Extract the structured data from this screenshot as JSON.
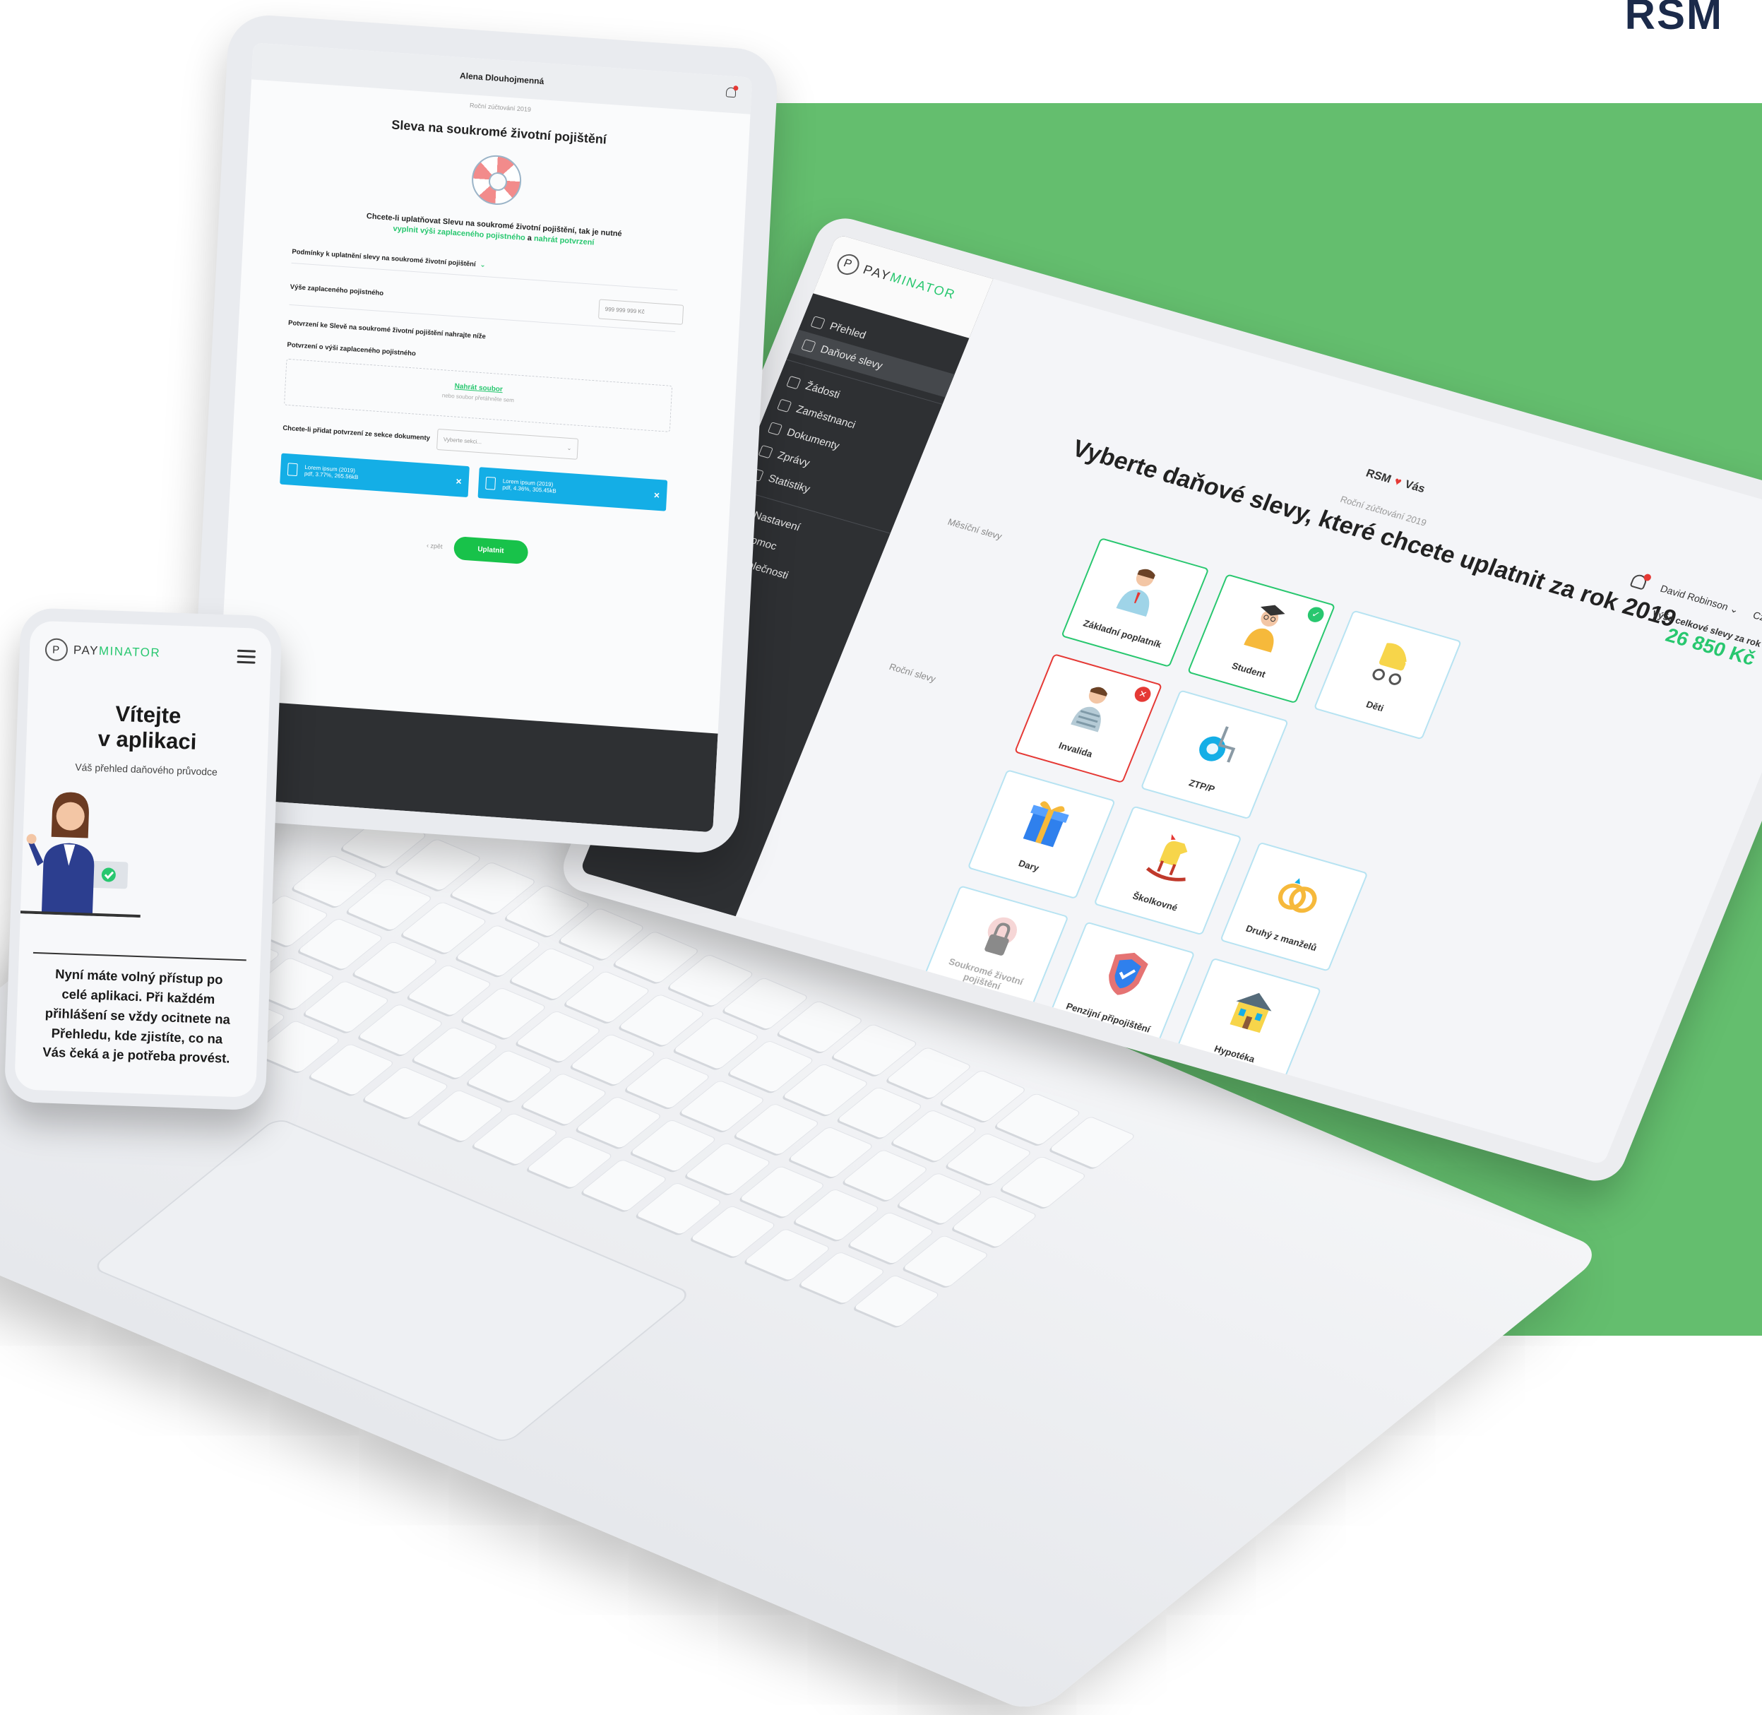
{
  "brand": "RSM",
  "colors": {
    "green_bg": "#64be6e",
    "accent_green": "#28c76f",
    "danger": "#e53935",
    "file_blue": "#14aee6",
    "sidebar_dark": "#2e3033"
  },
  "laptop": {
    "logo": {
      "pay": "PAY",
      "minator": "MINATOR",
      "mark": "P"
    },
    "nav": [
      {
        "label": "Přehled",
        "icon": "overview-icon"
      },
      {
        "label": "Daňové slevy",
        "icon": "tag-icon",
        "active": true
      },
      {
        "label": "Žádosti",
        "icon": "request-icon"
      },
      {
        "label": "Zaměstnanci",
        "icon": "people-icon"
      },
      {
        "label": "Dokumenty",
        "icon": "document-icon"
      },
      {
        "label": "Zprávy",
        "icon": "message-icon"
      },
      {
        "label": "Statistiky",
        "icon": "chart-icon"
      },
      {
        "label": "Nastavení",
        "icon": "gear-icon"
      },
      {
        "label": "Pomoc",
        "icon": "help-icon"
      },
      {
        "label": "Společnosti",
        "icon": "company-icon"
      }
    ],
    "company_left": "RSM",
    "company_right": "Vás",
    "subtitle": "Roční zúčtování 2019",
    "title": "Vyberte daňové slevy, které chcete uplatnit za rok 2019",
    "user": "David Robinson",
    "language": "Czech",
    "total_label": "Výše celkové slevy za rok",
    "total_value": "26 850 Kč",
    "section_monthly": "Měsíční slevy",
    "section_yearly": "Roční slevy",
    "tiles": [
      {
        "label": "Základní poplatník",
        "state": "selected",
        "icon": "taxpayer-icon"
      },
      {
        "label": "Student",
        "state": "selected",
        "icon": "student-icon"
      },
      {
        "label": "Děti",
        "state": "normal",
        "icon": "stroller-icon"
      },
      {
        "label": "Invalida",
        "state": "rejected",
        "icon": "disabled-person-icon"
      },
      {
        "label": "ZTP/P",
        "state": "normal",
        "icon": "wheelchair-icon"
      },
      {
        "label": "",
        "state": "spacer",
        "icon": ""
      },
      {
        "label": "Dary",
        "state": "normal",
        "icon": "gift-icon"
      },
      {
        "label": "Školkovné",
        "state": "normal",
        "icon": "rocking-horse-icon"
      },
      {
        "label": "Druhý z manželů",
        "state": "normal",
        "icon": "rings-icon"
      },
      {
        "label": "Soukromé životní pojištění",
        "state": "disabled",
        "icon": "lock-icon"
      },
      {
        "label": "Penzijní připojištění",
        "state": "normal",
        "icon": "shield-icon"
      },
      {
        "label": "Hypotéka",
        "state": "normal",
        "icon": "house-icon"
      }
    ]
  },
  "tablet": {
    "user": "Alena Dlouhojmenná",
    "subtitle": "Roční zúčtování 2019",
    "title": "Sleva na soukromé životní pojištění",
    "intro_1": "Chcete-li uplatňovat Slevu na soukromé životní pojištění, tak je nutné",
    "intro_link_1": "vyplnit výši zaplaceného pojistného",
    "intro_and": "a",
    "intro_link_2": "nahrát potvrzení",
    "conditions": "Podmínky k uplatnění slevy na soukromé životní pojištění",
    "amount_label": "Výše zaplaceného pojistného",
    "amount_placeholder": "999 999 999 Kč",
    "upload_heading": "Potvrzení ke Slevě na soukromé životní pojištění nahrajte níže",
    "upload_label": "Potvrzení o výši zaplaceného pojistného",
    "upload_link": "Nahrát soubor",
    "upload_hint": "nebo soubor přetáhněte sem",
    "docs_label": "Chcete-li přidat potvrzení ze sekce dokumenty",
    "docs_placeholder": "Vyberte sekci...",
    "files": [
      {
        "name": "Lorem ipsum (2019)",
        "meta": "pdf, 3.77%, 265.56kB"
      },
      {
        "name": "Lorem ipsum (2019)",
        "meta": "pdf, 4.36%, 305.45kB"
      }
    ],
    "back": "‹ zpět",
    "submit": "Uplatnit"
  },
  "phone": {
    "logo": {
      "pay": "PAY",
      "minator": "MINATOR",
      "mark": "P"
    },
    "title_1": "Vítejte",
    "title_2": "v aplikaci",
    "subtitle": "Váš přehled daňového průvodce",
    "body": "Nyní máte volný přístup po celé aplikaci. Při každém přihlášení se vždy ocitnete na Přehledu, kde zjistíte, co na Vás čeká a je potřeba provést."
  }
}
